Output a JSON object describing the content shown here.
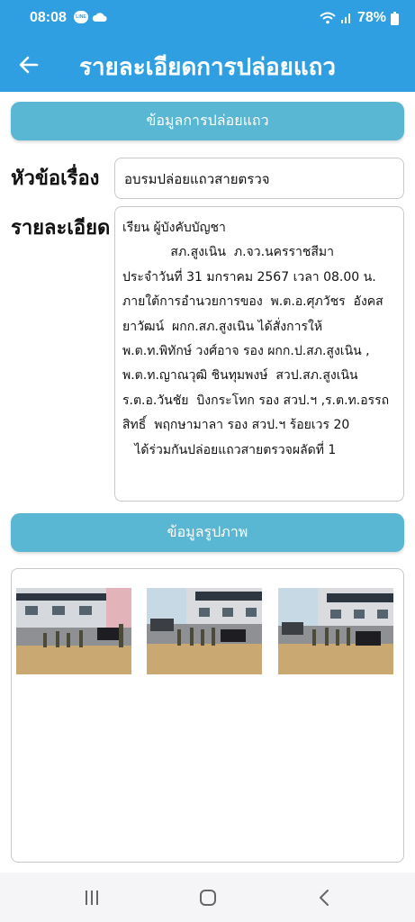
{
  "status_bar": {
    "time": "08:08",
    "line_badge": "LINE",
    "battery": "78%",
    "icons": [
      "line-icon",
      "cloud-icon",
      "wifi-icon",
      "signal-icon",
      "battery-icon"
    ]
  },
  "app_bar": {
    "title": "รายละเอียดการปล่อยแถว",
    "back_icon": "arrow-back-icon"
  },
  "sections": {
    "release_info": "ข้อมูลการปล่อยแถว",
    "photo_info": "ข้อมูลรูปภาพ"
  },
  "fields": {
    "subject_label": "หัวข้อเรื่อง",
    "subject_value": "อบรมปล่อยแถวสายตรวจ",
    "detail_label": "รายละเอียด",
    "detail_value": "เรียน ผู้บังคับบัญชา\n            สภ.สูงเนิน  ภ.จว.นครราชสีมา\nประจำวันที่ 31 มกราคม 2567 เวลา 08.00 น.\nภายใต้การอำนวยการของ  พ.ต.อ.ศุภวัชร  อังคสยาวัฒน์  ผกก.สภ.สูงเนิน ได้สั่งการให้\nพ.ต.ท.พิทักษ์ วงศ์อาจ รอง ผกก.ป.สภ.สูงเนิน ,\nพ.ต.ท.ญาณวุฒิ ชินทุมพงษ์  สวป.สภ.สูงเนิน\nร.ต.อ.วันชัย  บิงกระโทก รอง สวป.ฯ ,ร.ต.ท.อรรถสิทธิ์  พฤกษามาลา รอง สวป.ฯ ร้อยเวร 20\n   ได้ร่วมกันปล่อยแถวสายตรวจผลัดที่ 1"
  },
  "photos": [
    {
      "name": "photo-1"
    },
    {
      "name": "photo-2"
    },
    {
      "name": "photo-3"
    }
  ],
  "nav_bar": {
    "icons": [
      "recents-icon",
      "home-icon",
      "back-icon"
    ]
  },
  "colors": {
    "app_bar": "#2f9fe2",
    "section_header": "#5ab7d3"
  }
}
